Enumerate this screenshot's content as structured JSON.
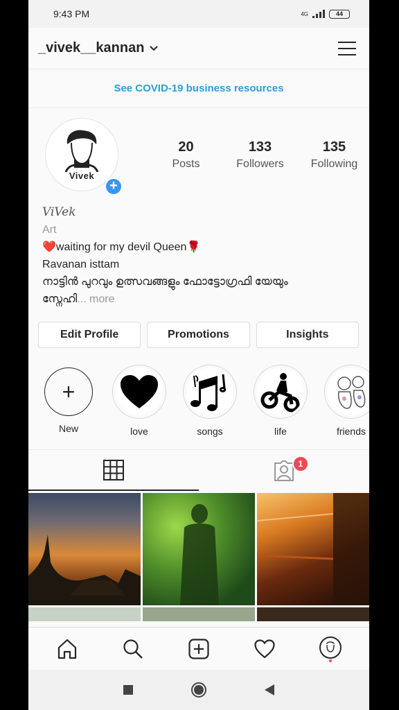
{
  "status": {
    "time": "9:43 PM",
    "network": "4G",
    "battery": "44"
  },
  "header": {
    "username": "_vivek__kannan"
  },
  "banner": {
    "text": "See COVID-19 business resources"
  },
  "profile": {
    "avatar_text": "Vivek",
    "stats": [
      {
        "value": "20",
        "label": "Posts"
      },
      {
        "value": "133",
        "label": "Followers"
      },
      {
        "value": "135",
        "label": "Following"
      }
    ]
  },
  "bio": {
    "display_name": "ViVek",
    "category": "Art",
    "line1": "❤️waiting for my devil Queen🌹",
    "line2": "Ravanan isttam",
    "line3": "നാട്ടിൻ പുറവും ഉത്സവങ്ങളും ഫോട്ടോഗ്രഫി യേയും",
    "line4": "സ്നേഹി",
    "more": "... more"
  },
  "actions": {
    "edit": "Edit Profile",
    "promotions": "Promotions",
    "insights": "Insights"
  },
  "highlights": [
    {
      "label": "New",
      "icon": "plus-icon"
    },
    {
      "label": "love",
      "icon": "heart-icon"
    },
    {
      "label": "songs",
      "icon": "music-notes-icon"
    },
    {
      "label": "life",
      "icon": "motorbike-icon"
    },
    {
      "label": "friends",
      "icon": "cartoon-friends-icon"
    }
  ],
  "tabs": {
    "tagged_badge": "1"
  },
  "colors": {
    "accent": "#3897f0",
    "link": "#2a9fd8",
    "badge": "#ed4956"
  }
}
